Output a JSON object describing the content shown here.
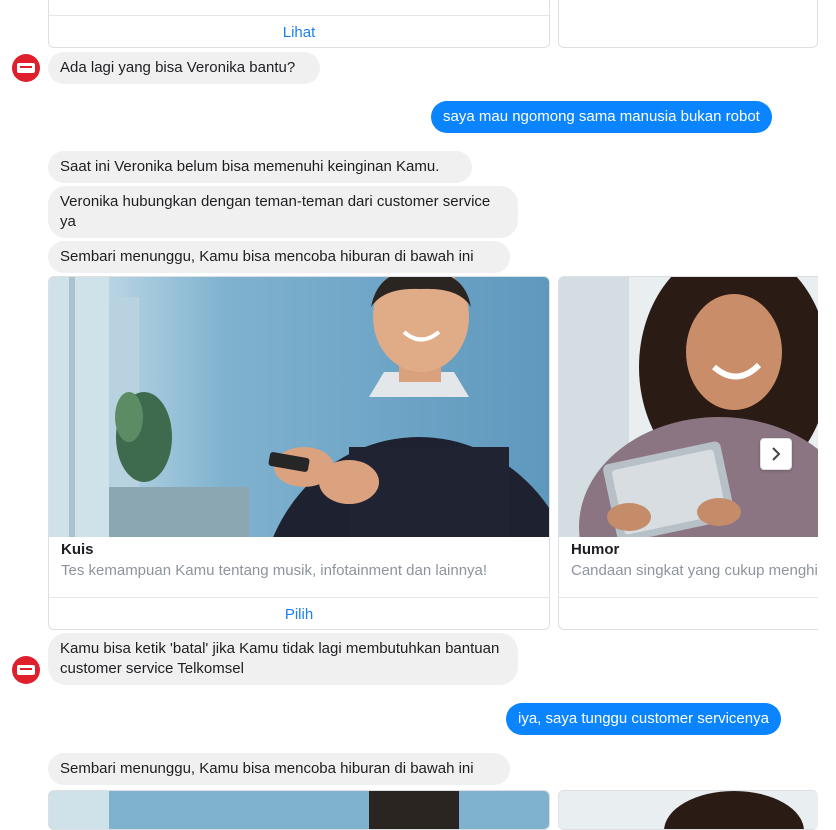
{
  "top_card": {
    "button_label": "Lihat"
  },
  "messages": {
    "bot_q1": "Ada lagi yang bisa Veronika bantu?",
    "user_1": "saya mau ngomong sama manusia bukan robot",
    "bot_1": "Saat ini Veronika belum bisa memenuhi keinginan Kamu.",
    "bot_2": "Veronika hubungkan dengan teman-teman dari customer service ya",
    "bot_3": "Sembari menunggu, Kamu bisa mencoba hiburan di bawah ini",
    "bot_4": "Kamu bisa ketik 'batal' jika Kamu tidak lagi membutuhkan bantuan customer service Telkomsel",
    "user_2": "iya, saya tunggu customer servicenya",
    "bot_5": "Sembari menunggu, Kamu bisa mencoba hiburan di bawah ini"
  },
  "carousel": [
    {
      "title": "Kuis",
      "subtitle": "Tes kemampuan Kamu tentang musik, infotainment dan lainnya!",
      "button_label": "Pilih"
    },
    {
      "title": "Humor",
      "subtitle": "Candaan singkat yang cukup menghibur"
    }
  ],
  "icons": {
    "avatar": "telkomsel-logo-icon",
    "next": "chevron-right-icon"
  },
  "colors": {
    "user_bubble": "#0a84ff",
    "bot_bubble": "#f0f0f0",
    "link": "#1d7ff0",
    "avatar": "#e01f2c"
  }
}
